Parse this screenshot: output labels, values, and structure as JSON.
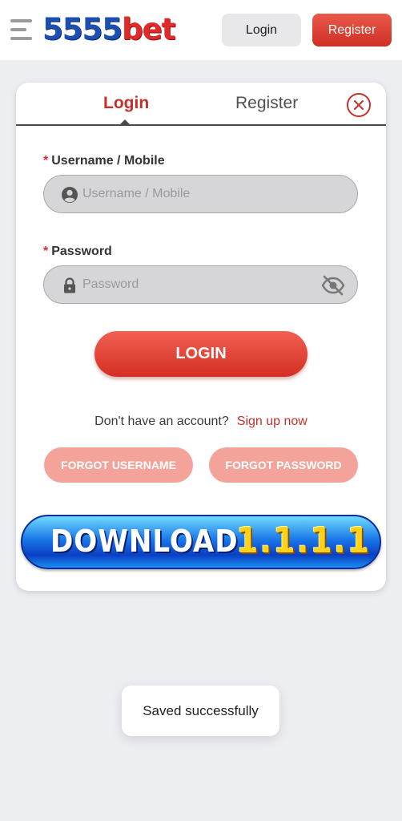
{
  "header": {
    "logo_number": "5555",
    "logo_word": "bet",
    "login_label": "Login",
    "register_label": "Register"
  },
  "tabs": {
    "login": "Login",
    "register": "Register"
  },
  "form": {
    "username_label": "Username / Mobile",
    "username_placeholder": "Username / Mobile",
    "password_label": "Password",
    "password_placeholder": "Password",
    "required_marker": "*",
    "login_button": "LOGIN"
  },
  "signup": {
    "prompt": "Don't have an account?",
    "link": "Sign up now"
  },
  "forgot": {
    "username": "FORGOT USERNAME",
    "password": "FORGOT PASSWORD"
  },
  "banner": {
    "text": "DOWNLOAD",
    "version": "1.1.1.1"
  },
  "toast": {
    "message": "Saved successfully"
  },
  "colors": {
    "accent": "#c4302b",
    "background": "#edeef2"
  },
  "icons": {
    "menu": "hamburger-icon",
    "close": "close-circle-icon",
    "user": "user-icon",
    "lock": "lock-icon",
    "visibility": "eye-off-icon"
  }
}
